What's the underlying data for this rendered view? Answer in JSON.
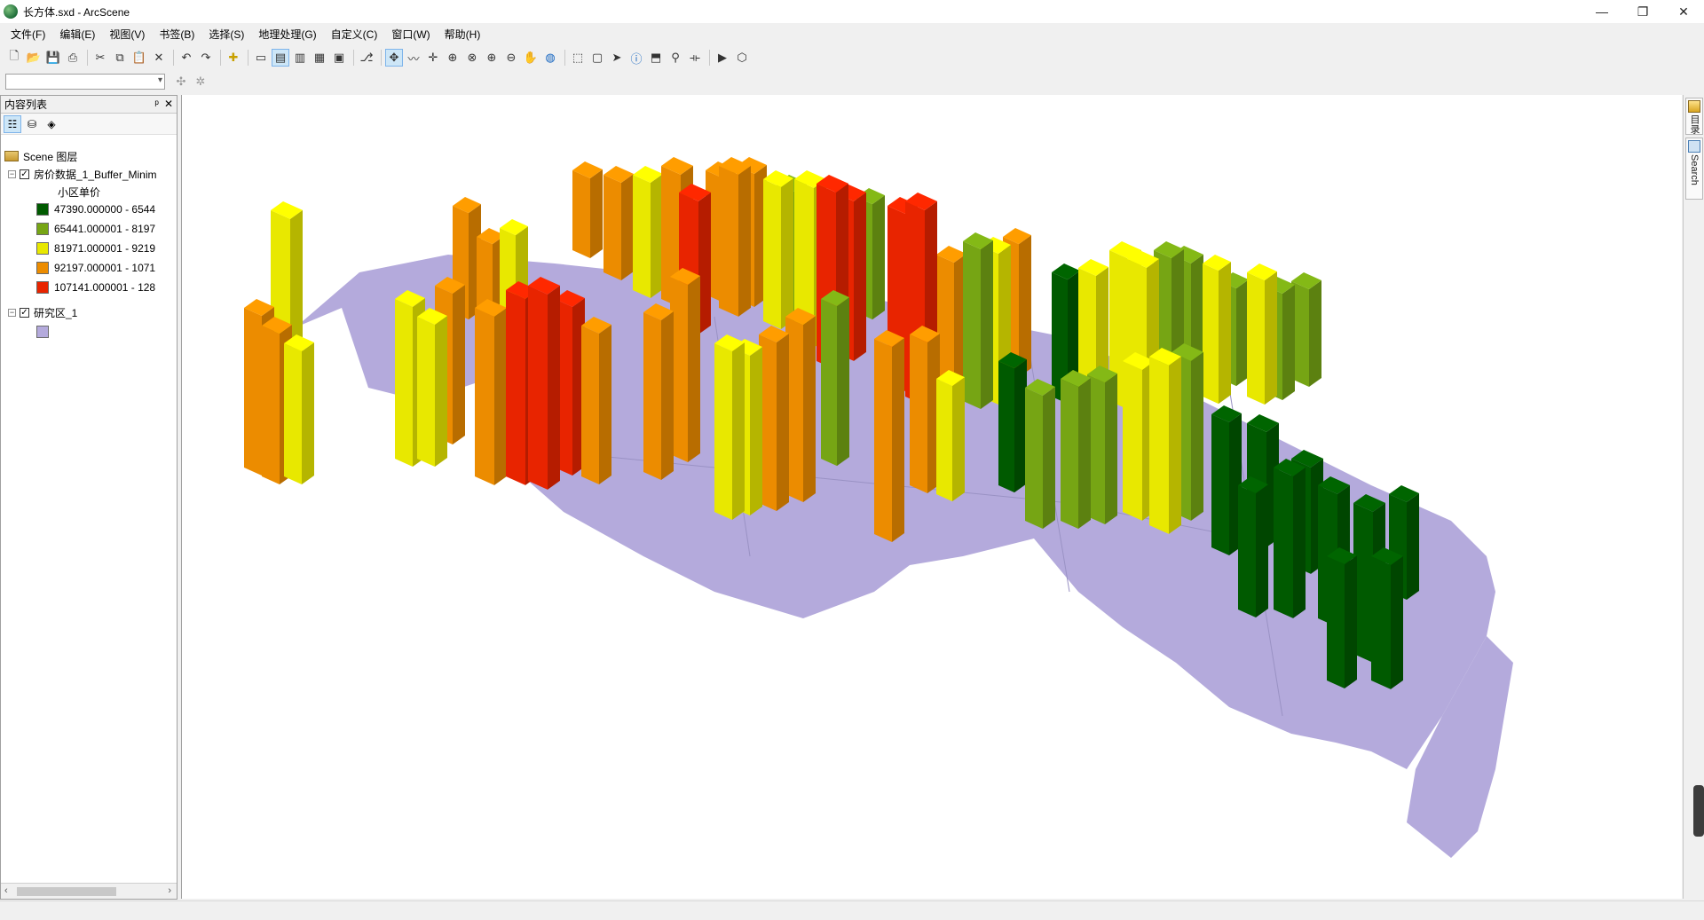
{
  "window": {
    "title": "长方体.sxd - ArcScene",
    "minimize": "—",
    "restore": "❐",
    "close": "✕"
  },
  "menu": [
    "文件(F)",
    "编辑(E)",
    "视图(V)",
    "书签(B)",
    "选择(S)",
    "地理处理(G)",
    "自定义(C)",
    "窗口(W)",
    "帮助(H)"
  ],
  "toolbar": {
    "icons": [
      "new-document-icon",
      "open-folder-icon",
      "save-icon",
      "print-icon",
      "|",
      "cut-icon",
      "copy-icon",
      "paste-icon",
      "delete-icon",
      "|",
      "undo-icon",
      "redo-icon",
      "|",
      "add-data-icon",
      "|",
      "scene-properties-icon",
      "toc-window-icon",
      "catalog-window-icon",
      "arctoolbox-icon",
      "python-window-icon",
      "|",
      "model-builder-icon",
      "|",
      "navigate-icon",
      "fly-icon",
      "target-center-icon",
      "zoom-to-target-icon",
      "set-observer-icon",
      "zoom-in-icon",
      "zoom-out-icon",
      "pan-icon",
      "full-extent-icon",
      "|",
      "select-features-icon",
      "clear-selection-icon",
      "select-elements-icon",
      "identify-icon",
      "html-popup-icon",
      "find-icon",
      "measure-icon",
      "|",
      "animation-icon",
      "3d-effects-icon"
    ]
  },
  "toc": {
    "title": "内容列表",
    "pin": "ᵖ",
    "close": "✕",
    "scene_layer": "Scene 图层",
    "layer1": {
      "name": "房价数据_1_Buffer_Minim",
      "checked": "✓",
      "field": "小区单价",
      "classes": [
        {
          "label": "47390.000000 - 6544",
          "color": "#005a00"
        },
        {
          "label": "65441.000001 - 8197",
          "color": "#76a514"
        },
        {
          "label": "81971.000001 - 9219",
          "color": "#e8e800"
        },
        {
          "label": "92197.000001 - 1071",
          "color": "#ec8c00"
        },
        {
          "label": "107141.000001 - 128",
          "color": "#e82400"
        }
      ]
    },
    "layer2": {
      "name": "研究区_1",
      "checked": "✓",
      "swatch_color": "#b4aadc"
    }
  },
  "rightdock": {
    "tab1": "目录",
    "tab2": "Search"
  }
}
